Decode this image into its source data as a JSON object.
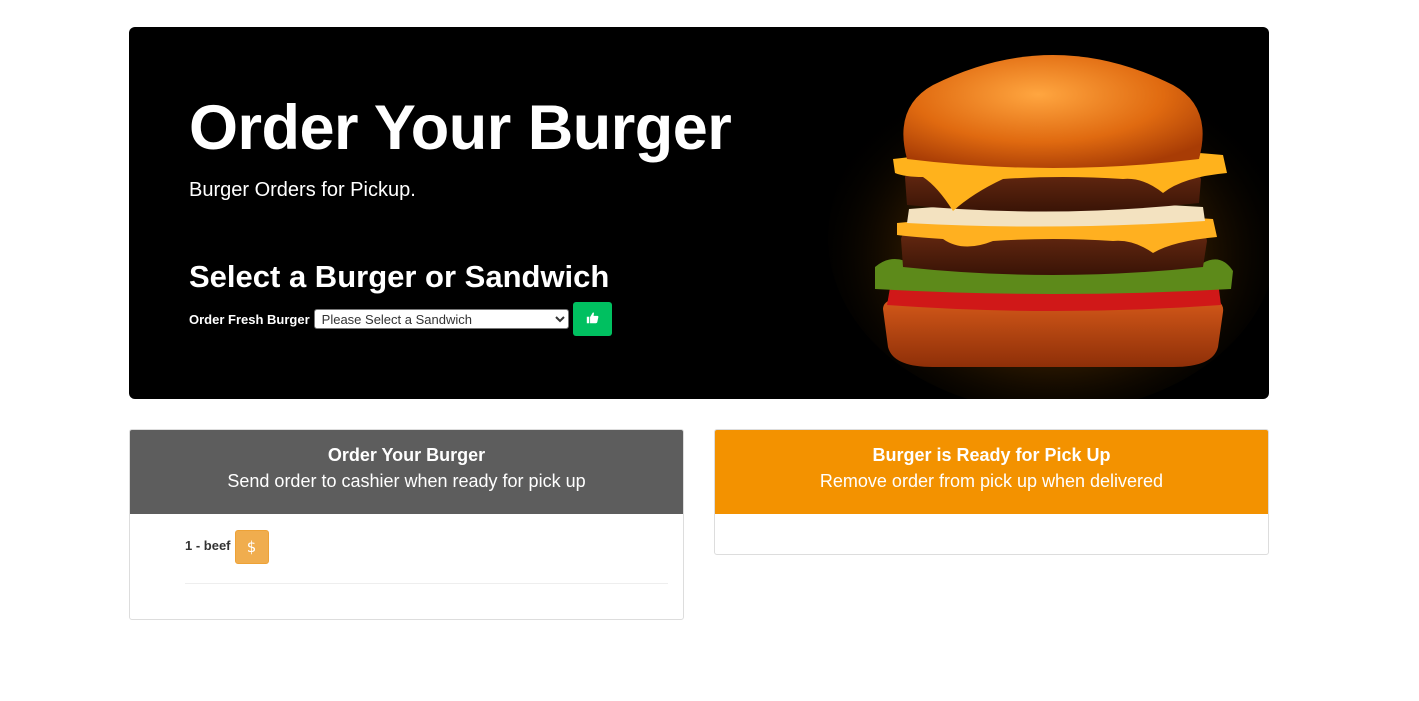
{
  "hero": {
    "title": "Order Your Burger",
    "subtitle": "Burger Orders for Pickup.",
    "select_heading": "Select a Burger or Sandwich",
    "order_label": "Order Fresh Burger",
    "select_value": "Please Select a Sandwich",
    "submit_icon": "thumbs-up-icon",
    "submit_color": "#00c060",
    "background": "#000000"
  },
  "left_panel": {
    "title": "Order Your Burger",
    "description": "Send order to cashier when ready for pick up",
    "header_color": "#5d5d5d",
    "orders": [
      {
        "label": "1 - beef",
        "action_icon": "dollar-icon",
        "action_text": "$"
      }
    ]
  },
  "right_panel": {
    "title": "Burger is Ready for Pick Up",
    "description": "Remove order from pick up when delivered",
    "header_color": "#f39200",
    "orders": []
  }
}
